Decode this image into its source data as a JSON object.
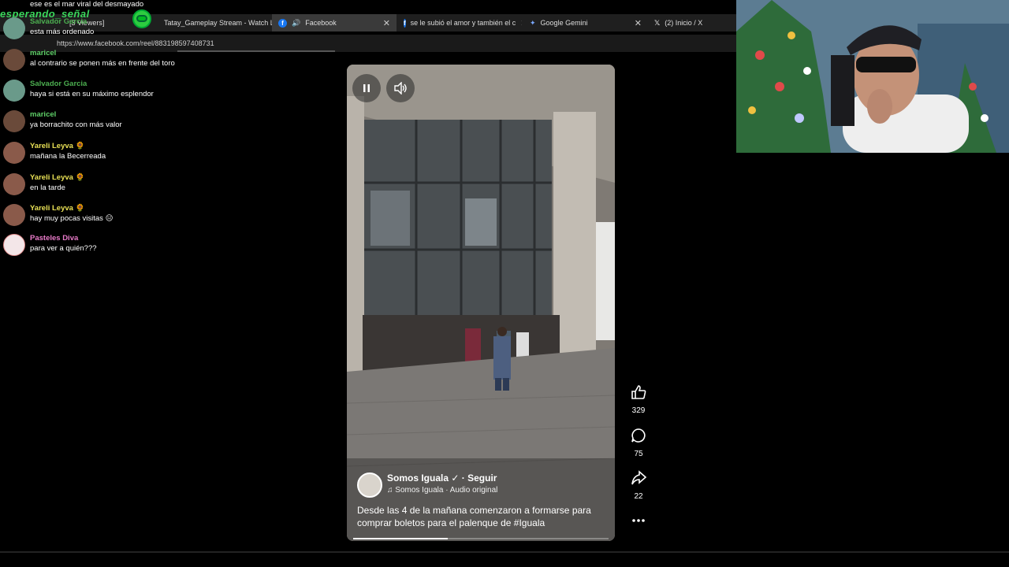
{
  "stream_overlay": {
    "title": "esperando_señal"
  },
  "browser": {
    "tabs": [
      {
        "label": "[3 Viewers]",
        "active": false
      },
      {
        "label": "Tatay_Gameplay Stream - Watch L",
        "active": false
      },
      {
        "label": "Facebook",
        "active": true
      },
      {
        "label": "se le subió el amor y también el c",
        "active": false
      },
      {
        "label": "Google Gemini",
        "active": false
      },
      {
        "label": "(2) Inicio / X",
        "active": false
      }
    ],
    "url": "https://www.facebook.com/reel/883198597408731"
  },
  "chat": {
    "messages": [
      {
        "name": "",
        "text": "ese es el mar viral del desmayado",
        "color": "#5fd068"
      },
      {
        "name": "Salvador Garcia",
        "text": "esta más ordenado",
        "color": "#4caf50"
      },
      {
        "name": "maricel",
        "text": "al contrario se ponen más en frente del toro",
        "color": "#5fd068"
      },
      {
        "name": "Salvador Garcia",
        "text": "haya si está en su máximo esplendor",
        "color": "#4caf50"
      },
      {
        "name": "maricel",
        "text": "ya borrachito con más valor",
        "color": "#5fd068"
      },
      {
        "name": "Yareli Leyva 🌻",
        "text": "mañana la Becerreada",
        "color": "#e8e055"
      },
      {
        "name": "Yareli Leyva 🌻",
        "text": "en la tarde",
        "color": "#e8e055"
      },
      {
        "name": "Yareli Leyva 🌻",
        "text": "hay muy pocas visitas 😑",
        "color": "#e8e055"
      },
      {
        "name": "Pasteles Diva",
        "text": "para ver a quién???",
        "color": "#e87ac8"
      }
    ]
  },
  "reel": {
    "author": "Somos Iguala",
    "follow": "· Seguir",
    "audio": "Somos Iguala · Audio original",
    "caption": "Desde las 4 de la mañana comenzaron a formarse para comprar boletos para el palenque de #Iguala",
    "progress": 0.37,
    "actions": {
      "likes": "329",
      "comments": "75",
      "shares": "22"
    }
  },
  "colors": {
    "facebook_blue": "#1877f2",
    "overlay_green": "#3ad65b"
  }
}
